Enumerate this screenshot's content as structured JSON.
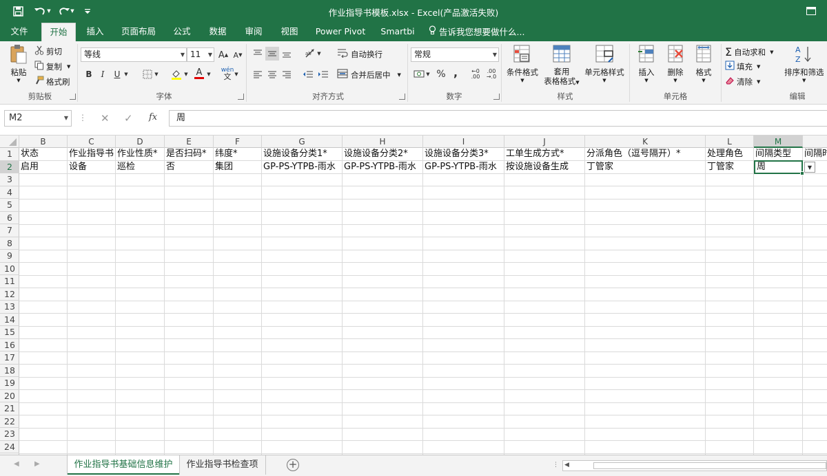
{
  "window": {
    "title": "作业指导书模板.xlsx - Excel(产品激活失败)"
  },
  "qat": {
    "save_icon": "save-icon",
    "undo_icon": "undo-icon",
    "redo_icon": "redo-icon",
    "customize_icon": "customize-icon"
  },
  "tabs": [
    {
      "label": "文件"
    },
    {
      "label": "开始"
    },
    {
      "label": "插入"
    },
    {
      "label": "页面布局"
    },
    {
      "label": "公式"
    },
    {
      "label": "数据"
    },
    {
      "label": "审阅"
    },
    {
      "label": "视图"
    },
    {
      "label": "Power Pivot"
    },
    {
      "label": "Smartbi"
    }
  ],
  "tell_me": "告诉我您想要做什么...",
  "ribbon": {
    "clipboard": {
      "paste": "粘贴",
      "cut": "剪切",
      "copy": "复制",
      "format_painter": "格式刷",
      "group": "剪贴板"
    },
    "font": {
      "name": "等线",
      "size": "11",
      "bold": "B",
      "italic": "I",
      "underline": "U",
      "group": "字体"
    },
    "alignment": {
      "wrap": "自动换行",
      "merge": "合并后居中",
      "group": "对齐方式"
    },
    "number": {
      "format": "常规",
      "percent": "%",
      "comma": ",",
      "group": "数字"
    },
    "styles": {
      "conditional": "条件格式",
      "table_line1": "套用",
      "table_line2": "表格格式",
      "cell_styles": "单元格样式",
      "group": "样式"
    },
    "cells": {
      "insert": "插入",
      "delete": "删除",
      "format": "格式",
      "group": "单元格"
    },
    "editing": {
      "autosum": "自动求和",
      "fill": "填充",
      "clear": "清除",
      "sort": "排序和筛选",
      "group": "编辑"
    }
  },
  "formula_bar": {
    "name_box": "M2",
    "cancel": "✕",
    "enter": "✓",
    "fx": "fx",
    "value": "周"
  },
  "columns": [
    "B",
    "C",
    "D",
    "E",
    "F",
    "G",
    "H",
    "I",
    "J",
    "K",
    "L",
    "M",
    ""
  ],
  "row_numbers": [
    "1",
    "2",
    "3",
    "4",
    "5",
    "6",
    "7",
    "8",
    "9",
    "10",
    "11",
    "12",
    "13",
    "14",
    "15",
    "16",
    "17",
    "18",
    "19",
    "20",
    "21",
    "22",
    "23",
    "24"
  ],
  "rows": [
    [
      "状态",
      "作业指导书",
      "作业性质*",
      "是否扫码*",
      "纬度*",
      "设施设备分类1*",
      "设施设备分类2*",
      "设施设备分类3*",
      "工单生成方式*",
      "分派角色（逗号隔开）*",
      "处理角色",
      "间隔类型",
      "间隔时"
    ],
    [
      "启用",
      "设备",
      "巡检",
      "否",
      "集团",
      "GP-PS-YTPB-雨水",
      "GP-PS-YTPB-雨水",
      "GP-PS-YTPB-雨水",
      "按设施设备生成",
      "丁管家",
      "丁管家",
      "周",
      ""
    ]
  ],
  "sheets": [
    {
      "label": "作业指导书基础信息维护",
      "active": true
    },
    {
      "label": "作业指导书检查项",
      "active": false
    }
  ],
  "colors": {
    "brand": "#217346",
    "ribbon": "#f3f3f3",
    "grid": "#dadada"
  }
}
